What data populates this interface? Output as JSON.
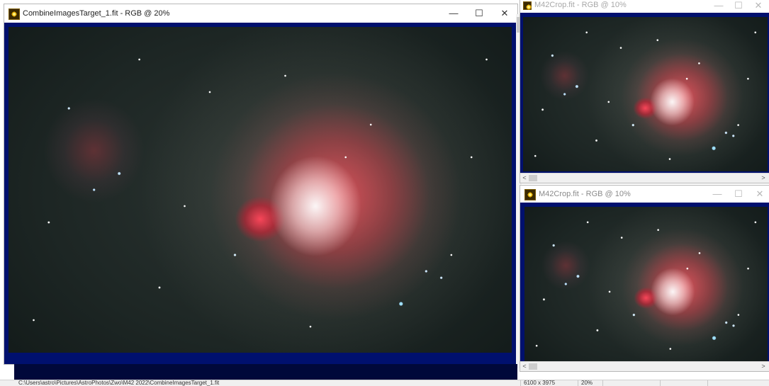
{
  "main_window": {
    "title": "CombineImagesTarget_1.fit - RGB @ 20%",
    "controls": {
      "minimize": "—",
      "maximize": "☐",
      "close": "✕"
    },
    "icon": "app-icon"
  },
  "top_right_window": {
    "title": "M42Crop.fit - RGB @ 10%",
    "controls": {
      "minimize": "—",
      "maximize": "☐",
      "close": "✕"
    },
    "scroll_left": "<",
    "scroll_right": ">"
  },
  "bottom_right_window": {
    "title": "M42Crop.fit - RGB @ 10%",
    "controls": {
      "minimize": "—",
      "maximize": "☐",
      "close": "✕"
    },
    "scroll_left": "<",
    "scroll_right": ">"
  },
  "status_bar": {
    "path": "C:\\Users\\astro\\Pictures\\AstroPhotos\\Zwo\\M42 2022\\CombineImagesTarget_1.fit",
    "dimensions": "6100 x 3975",
    "zoom": "20%"
  },
  "colors": {
    "frame": "#00106e",
    "status_bg": "#f0f0f0"
  }
}
